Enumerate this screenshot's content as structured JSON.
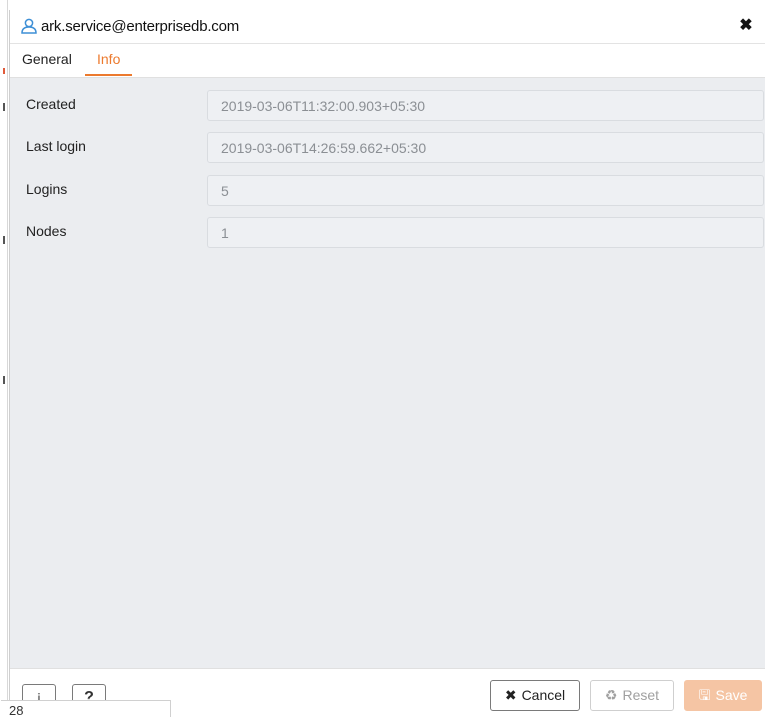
{
  "dialog": {
    "title": "ark.service@enterprisedb.com",
    "close_glyph": "✖",
    "title_icon": "user-icon"
  },
  "tabs": [
    {
      "label": "General",
      "active": false
    },
    {
      "label": "Info",
      "active": true
    }
  ],
  "fields": [
    {
      "label": "Created",
      "value": "2019-03-06T11:32:00.903+05:30"
    },
    {
      "label": "Last login",
      "value": "2019-03-06T14:26:59.662+05:30"
    },
    {
      "label": "Logins",
      "value": "5"
    },
    {
      "label": "Nodes",
      "value": "1"
    }
  ],
  "footer": {
    "info_glyph": "i",
    "help_glyph": "?",
    "cancel_label": "Cancel",
    "cancel_glyph": "✖",
    "reset_label": "Reset",
    "reset_glyph": "♻",
    "save_label": "Save",
    "save_glyph": "🖫",
    "status_text": "28"
  },
  "colors": {
    "accent": "#ec7a2e",
    "content_bg": "#ebedf0",
    "save_bg": "#f5c5a4"
  }
}
